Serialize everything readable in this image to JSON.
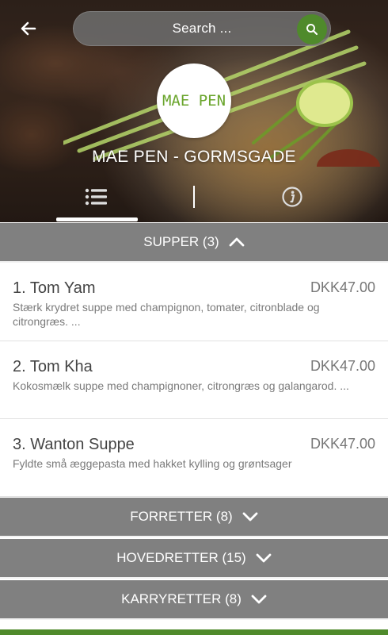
{
  "header": {
    "search_placeholder": "Search ...",
    "restaurant_name": "MAE PEN - GORMSGADE",
    "logo_text": "MAE PEN",
    "tabs": [
      "menu-list",
      "reviews",
      "info"
    ],
    "accent_color": "#4f8a2b"
  },
  "categories": [
    {
      "title": "SUPPER (3)",
      "expanded": true,
      "items": [
        {
          "name": "1. Tom Yam",
          "price": "DKK47.00",
          "description": "Stærk krydret suppe med champignon, tomater, citronblade og citrongræs.  ..."
        },
        {
          "name": "2. Tom Kha",
          "price": "DKK47.00",
          "description": "Kokosmælk suppe med champignoner, citrongræs og galangarod.  ..."
        },
        {
          "name": "3. Wanton Suppe",
          "price": "DKK47.00",
          "description": "Fyldte små æggepasta med hakket kylling og grøntsager"
        }
      ]
    },
    {
      "title": "FORRETTER (8)",
      "expanded": false
    },
    {
      "title": "HOVEDRETTER (15)",
      "expanded": false
    },
    {
      "title": "KARRYRETTER (8)",
      "expanded": false
    }
  ]
}
